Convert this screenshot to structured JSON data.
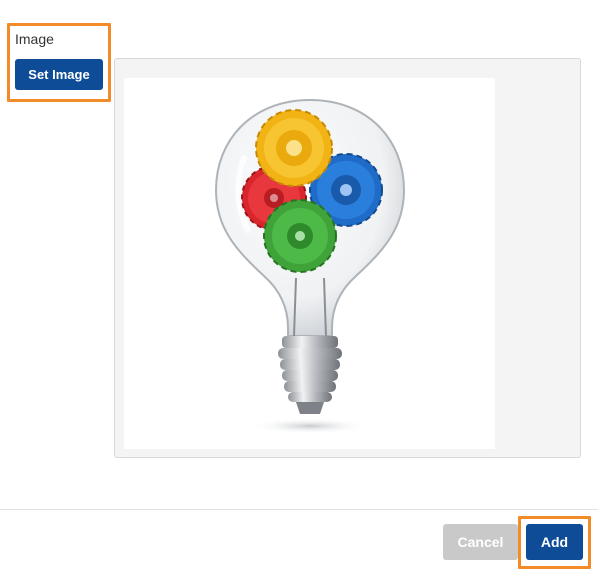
{
  "form": {
    "image_label": "Image",
    "set_image_label": "Set Image"
  },
  "preview": {
    "image_name": "lightbulb-with-gears-icon"
  },
  "footer": {
    "cancel_label": "Cancel",
    "add_label": "Add"
  },
  "colors": {
    "primary_button": "#0f4c97",
    "disabled_button": "#c9c9c9",
    "highlight_outline": "#f28c28"
  }
}
